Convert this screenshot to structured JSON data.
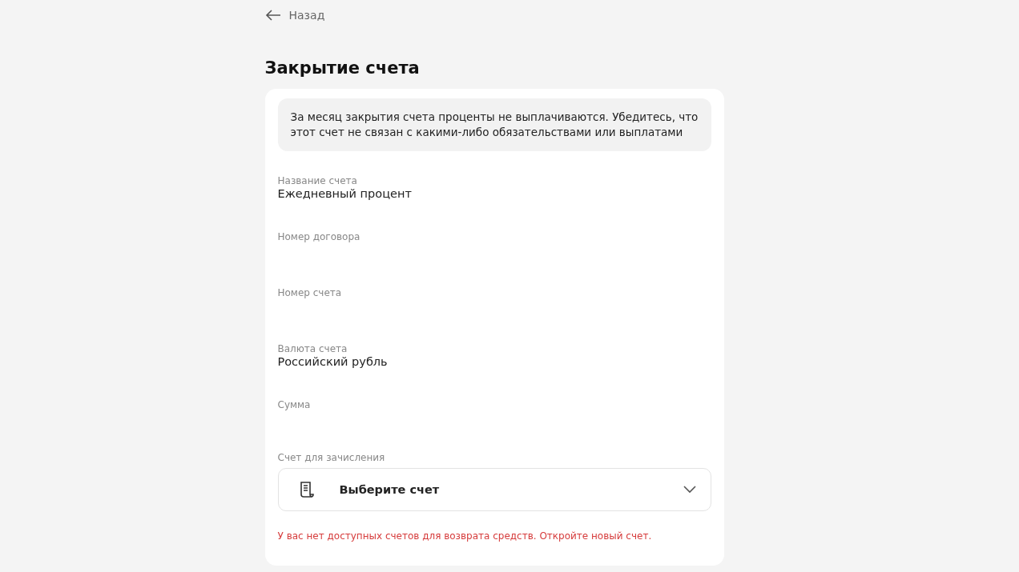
{
  "back": {
    "label": "Назад"
  },
  "title": "Закрытие счета",
  "notice": "За месяц закрытия счета проценты не выплачиваются. Убедитесь, что этот счет не связан с какими-либо обязательствами или выплатами",
  "fields": [
    {
      "label": "Название счета",
      "value": "Ежедневный процент"
    },
    {
      "label": "Номер договора"
    },
    {
      "label": "Номер счета"
    },
    {
      "label": "Валюта счета",
      "value": "Российский рубль"
    },
    {
      "label": "Сумма"
    }
  ],
  "target": {
    "label": "Счет для зачисления",
    "placeholder": "Выберите счет",
    "error": "У вас нет доступных счетов для возврата средств. Откройте новый счет."
  }
}
